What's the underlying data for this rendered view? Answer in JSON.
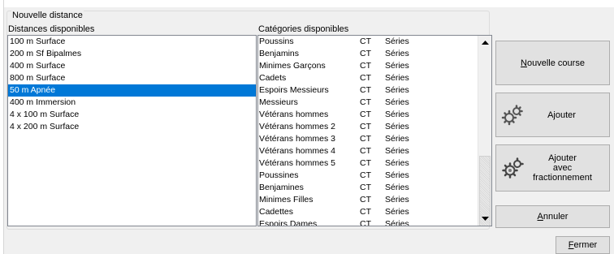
{
  "group": {
    "title": "Nouvelle distance"
  },
  "distances": {
    "label": "Distances disponibles",
    "items": [
      "100 m Surface",
      "200 m Sf Bipalmes",
      "400 m Surface",
      "800 m Surface",
      "50 m Apnée",
      "400 m Immersion",
      "4 x 100 m Surface",
      "4 x 200 m Surface"
    ],
    "selected_index": 4
  },
  "categories": {
    "label": "Catégories disponibles",
    "rows": [
      {
        "name": "Poussins",
        "code": "CT",
        "type": "Séries"
      },
      {
        "name": "Benjamins",
        "code": "CT",
        "type": "Séries"
      },
      {
        "name": "Minimes Garçons",
        "code": "CT",
        "type": "Séries"
      },
      {
        "name": "Cadets",
        "code": "CT",
        "type": "Séries"
      },
      {
        "name": "Espoirs Messieurs",
        "code": "CT",
        "type": "Séries"
      },
      {
        "name": "Messieurs",
        "code": "CT",
        "type": "Séries"
      },
      {
        "name": "Vétérans hommes",
        "code": "CT",
        "type": "Séries"
      },
      {
        "name": "Vétérans hommes 2",
        "code": "CT",
        "type": "Séries"
      },
      {
        "name": "Vétérans hommes 3",
        "code": "CT",
        "type": "Séries"
      },
      {
        "name": "Vétérans hommes 4",
        "code": "CT",
        "type": "Séries"
      },
      {
        "name": "Vétérans hommes 5",
        "code": "CT",
        "type": "Séries"
      },
      {
        "name": "Poussines",
        "code": "CT",
        "type": "Séries"
      },
      {
        "name": "Benjamines",
        "code": "CT",
        "type": "Séries"
      },
      {
        "name": "Minimes Filles",
        "code": "CT",
        "type": "Séries"
      },
      {
        "name": "Cadettes",
        "code": "CT",
        "type": "Séries"
      },
      {
        "name": "Espoirs Dames",
        "code": "CT",
        "type": "Séries"
      }
    ]
  },
  "buttons": {
    "new_race": {
      "accel": "N",
      "rest": "ouvelle course"
    },
    "add": {
      "label": "Ajouter",
      "icon": "gears-icon"
    },
    "add_split": {
      "line1": "Ajouter",
      "line2": "avec",
      "line3": "fractionnement",
      "icon": "gears-icon"
    },
    "cancel": {
      "accel": "A",
      "rest": "nnuler"
    },
    "close": {
      "accel": "F",
      "rest": "ermer"
    }
  }
}
